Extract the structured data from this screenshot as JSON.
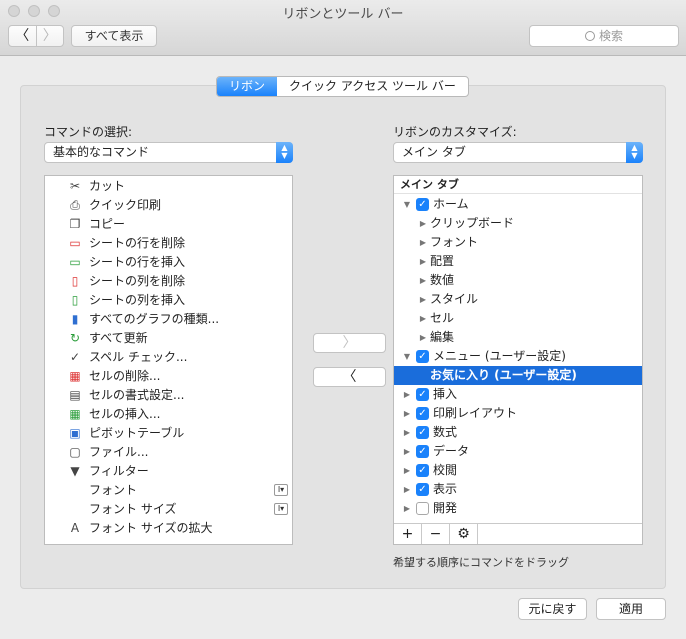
{
  "window": {
    "title": "リボンとツール バー"
  },
  "toolbar": {
    "back_glyph": "〈",
    "forward_glyph": "〉",
    "show_all_label": "すべて表示",
    "search_placeholder": "検索"
  },
  "tabs": [
    {
      "label": "リボン",
      "active": true
    },
    {
      "label": "クイック アクセス ツール バー",
      "active": false
    }
  ],
  "left": {
    "label": "コマンドの選択:",
    "dropdown_value": "基本的なコマンド",
    "commands": [
      {
        "label": "カット",
        "icon": "scissors-icon"
      },
      {
        "label": "クイック印刷",
        "icon": "quick-print-icon"
      },
      {
        "label": "コピー",
        "icon": "copy-icon"
      },
      {
        "label": "シートの行を削除",
        "icon": "delete-row-icon"
      },
      {
        "label": "シートの行を挿入",
        "icon": "insert-row-icon"
      },
      {
        "label": "シートの列を削除",
        "icon": "delete-column-icon"
      },
      {
        "label": "シートの列を挿入",
        "icon": "insert-column-icon"
      },
      {
        "label": "すべてのグラフの種類...",
        "icon": "chart-icon"
      },
      {
        "label": "すべて更新",
        "icon": "refresh-icon"
      },
      {
        "label": "スペル チェック...",
        "icon": "spellcheck-icon"
      },
      {
        "label": "セルの削除...",
        "icon": "delete-cells-icon"
      },
      {
        "label": "セルの書式設定...",
        "icon": "format-cells-icon"
      },
      {
        "label": "セルの挿入...",
        "icon": "insert-cells-icon"
      },
      {
        "label": "ピボットテーブル",
        "icon": "pivot-table-icon"
      },
      {
        "label": "ファイル...",
        "icon": "file-icon"
      },
      {
        "label": "フィルター",
        "icon": "filter-icon"
      },
      {
        "label": "フォント",
        "icon": ""
      },
      {
        "label": "フォント サイズ",
        "icon": ""
      },
      {
        "label": "フォント サイズの拡大",
        "icon": "font-size-increase-icon"
      }
    ]
  },
  "middle": {
    "add_glyph": "〉",
    "remove_glyph": "〈"
  },
  "right": {
    "label": "リボンのカスタマイズ:",
    "dropdown_value": "メイン タブ",
    "tree_header": "メイン タブ",
    "items": [
      {
        "label": "ホーム",
        "level": 0,
        "expanded": true,
        "checked": true
      },
      {
        "label": "クリップボード",
        "level": 1
      },
      {
        "label": "フォント",
        "level": 1
      },
      {
        "label": "配置",
        "level": 1
      },
      {
        "label": "数値",
        "level": 1
      },
      {
        "label": "スタイル",
        "level": 1
      },
      {
        "label": "セル",
        "level": 1
      },
      {
        "label": "編集",
        "level": 1
      },
      {
        "label": "メニュー (ユーザー設定)",
        "level": 0,
        "expanded": true,
        "checked": true
      },
      {
        "label": "お気に入り (ユーザー設定)",
        "level": 1,
        "selected": true
      },
      {
        "label": "挿入",
        "level": 0,
        "checked": true
      },
      {
        "label": "印刷レイアウト",
        "level": 0,
        "checked": true
      },
      {
        "label": "数式",
        "level": 0,
        "checked": true
      },
      {
        "label": "データ",
        "level": 0,
        "checked": true
      },
      {
        "label": "校閲",
        "level": 0,
        "checked": true
      },
      {
        "label": "表示",
        "level": 0,
        "checked": true
      },
      {
        "label": "開発",
        "level": 0,
        "checked": false
      }
    ],
    "tools": {
      "add": "+",
      "remove": "−",
      "settings": "⚙"
    }
  },
  "hint": "希望する順序にコマンドをドラッグ",
  "footer": {
    "revert_label": "元に戻す",
    "apply_label": "適用"
  },
  "colors": {
    "accent": "#1a82fb",
    "selection": "#1a6ddb"
  }
}
